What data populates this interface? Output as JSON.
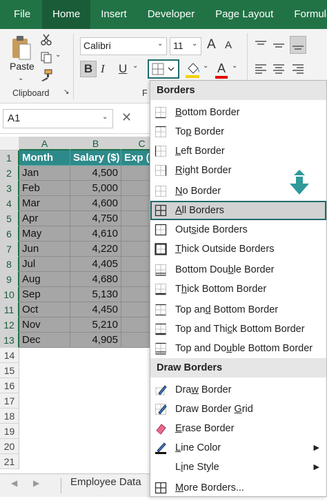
{
  "tabs": [
    "File",
    "Home",
    "Insert",
    "Developer",
    "Page Layout",
    "Formulas"
  ],
  "ribbon": {
    "paste_label": "Paste",
    "clipboard_label": "Clipboard",
    "font_name": "Calibri",
    "font_size": "11",
    "font_group_label_partial": "F",
    "bold": "B",
    "italic": "I",
    "underline": "U",
    "grow_font": "A",
    "shrink_font": "A",
    "font_color": "A"
  },
  "formula_bar": {
    "name_box": "A1",
    "cancel": "✕"
  },
  "columns": [
    "A",
    "B",
    "C"
  ],
  "rows": [
    "1",
    "2",
    "3",
    "4",
    "5",
    "6",
    "7",
    "8",
    "9",
    "10",
    "11",
    "12",
    "13",
    "14",
    "15",
    "16",
    "17",
    "18",
    "19",
    "20",
    "21"
  ],
  "table": {
    "headers": [
      "Month",
      "Salary ($)",
      "Exp ($"
    ],
    "data": [
      [
        "Jan",
        "4,500"
      ],
      [
        "Feb",
        "5,000"
      ],
      [
        "Mar",
        "4,600"
      ],
      [
        "Apr",
        "4,750"
      ],
      [
        "May",
        "4,610"
      ],
      [
        "Jun",
        "4,220"
      ],
      [
        "Jul",
        "4,405"
      ],
      [
        "Aug",
        "4,680"
      ],
      [
        "Sep",
        "5,130"
      ],
      [
        "Oct",
        "4,450"
      ],
      [
        "Nov",
        "5,210"
      ],
      [
        "Dec",
        "4,905"
      ]
    ]
  },
  "sheet_tab": "Employee Data",
  "menu": {
    "section1": "Borders",
    "items1": [
      {
        "pre": "",
        "u": "B",
        "post": "ottom Border"
      },
      {
        "pre": "To",
        "u": "p",
        "post": " Border"
      },
      {
        "pre": "",
        "u": "L",
        "post": "eft Border"
      },
      {
        "pre": "",
        "u": "R",
        "post": "ight Border"
      },
      {
        "pre": "",
        "u": "N",
        "post": "o Border"
      },
      {
        "pre": "",
        "u": "A",
        "post": "ll Borders"
      },
      {
        "pre": "Out",
        "u": "s",
        "post": "ide Borders"
      },
      {
        "pre": "",
        "u": "T",
        "post": "hick Outside Borders"
      },
      {
        "pre": "Bottom Dou",
        "u": "b",
        "post": "le Border"
      },
      {
        "pre": "T",
        "u": "h",
        "post": "ick Bottom Border"
      },
      {
        "pre": "Top an",
        "u": "d",
        "post": " Bottom Border"
      },
      {
        "pre": "Top and Thi",
        "u": "c",
        "post": "k Bottom Border"
      },
      {
        "pre": "Top and Do",
        "u": "u",
        "post": "ble Bottom Border"
      }
    ],
    "section2": "Draw Borders",
    "items2": [
      {
        "pre": "Dra",
        "u": "w",
        "post": " Border"
      },
      {
        "pre": "Draw Border ",
        "u": "G",
        "post": "rid"
      },
      {
        "pre": "",
        "u": "E",
        "post": "rase Border"
      },
      {
        "pre": "",
        "u": "L",
        "post": "ine Color"
      },
      {
        "pre": "L",
        "u": "i",
        "post": "ne Style"
      },
      {
        "pre": "",
        "u": "M",
        "post": "ore Borders..."
      }
    ],
    "submenu_arrow": "▶"
  },
  "colors": {
    "accent": "#217346",
    "header_fill": "#2e8a8a",
    "data_fill": "#a6a6a6",
    "highlight_border": "#1f6b6b"
  }
}
